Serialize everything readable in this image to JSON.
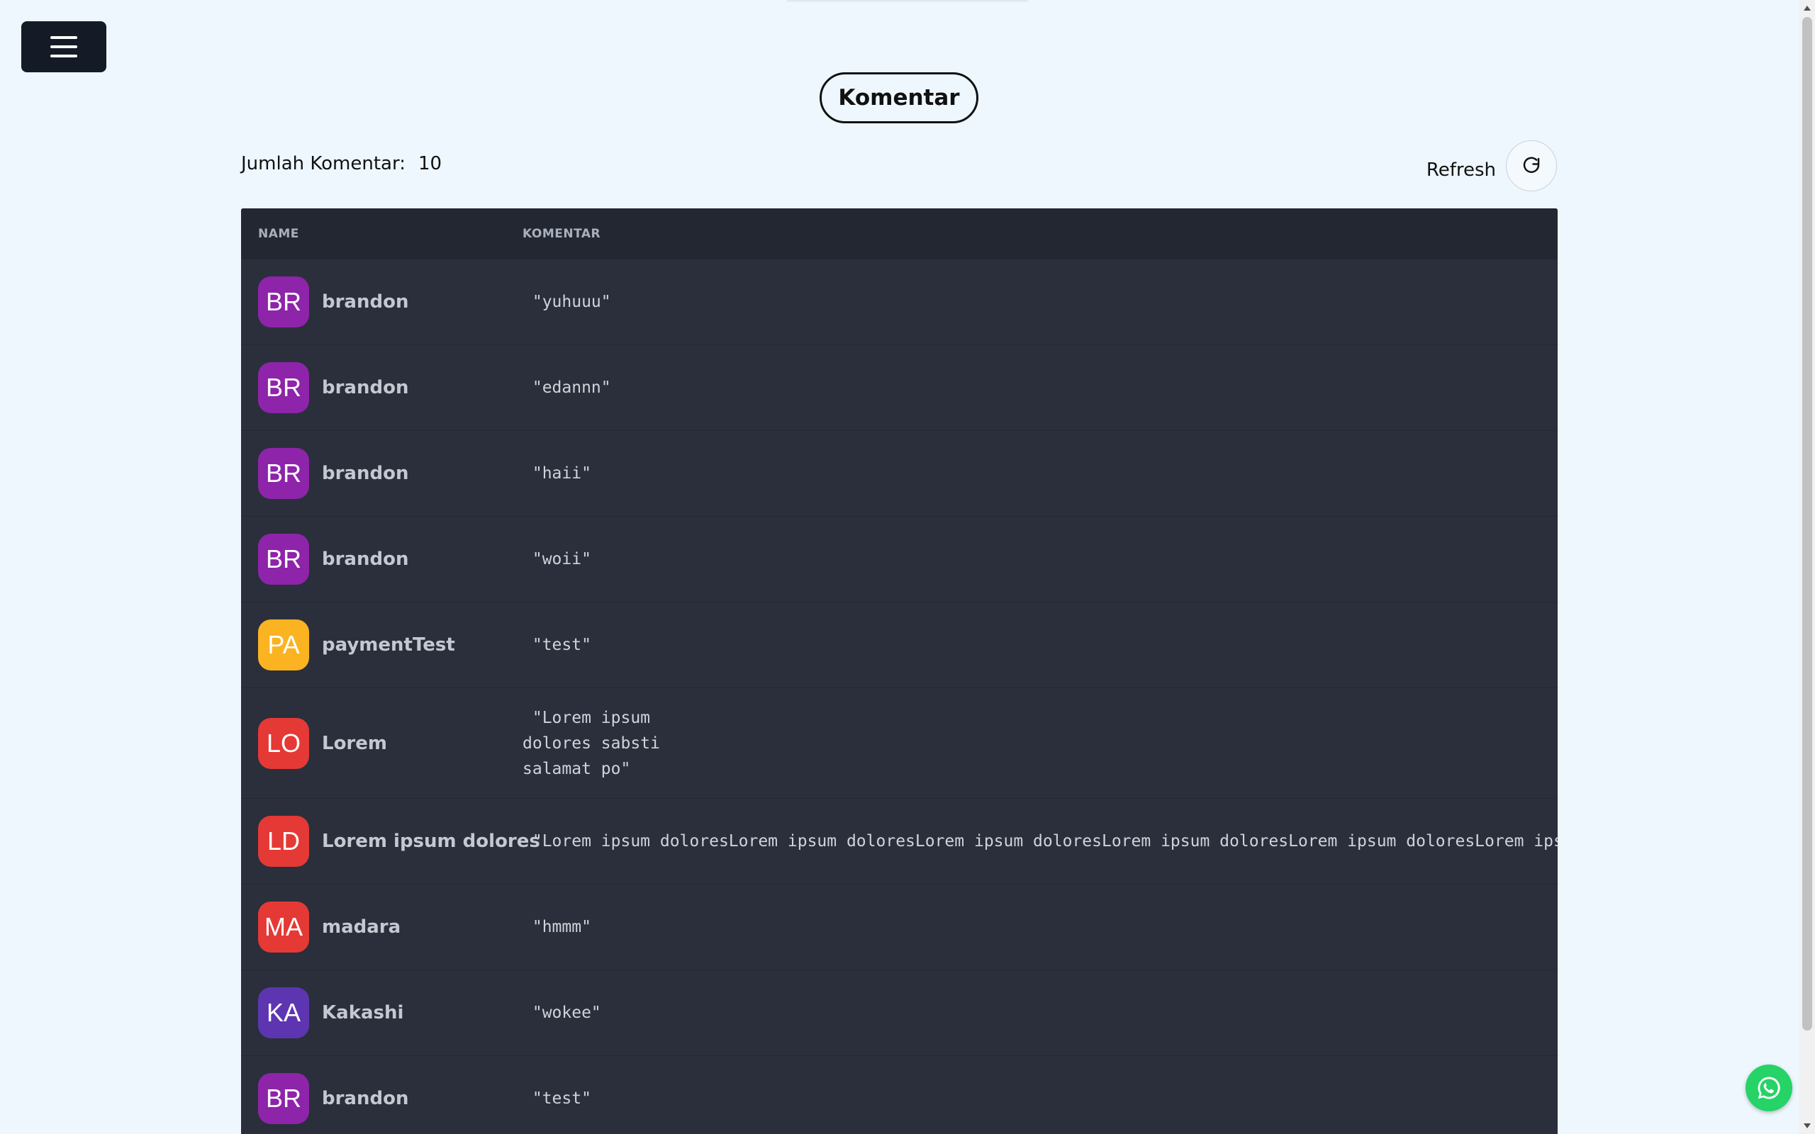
{
  "page": {
    "title": "Komentar",
    "count_label": "Jumlah Komentar:",
    "count_value": "10",
    "refresh_label": "Refresh"
  },
  "table": {
    "headers": {
      "name": "NAME",
      "komentar": "KOMENTAR"
    },
    "rows": [
      {
        "initials": "BR",
        "name": "brandon",
        "comment": " \"yuhuuu\"",
        "avatar_color": "#8e24aa"
      },
      {
        "initials": "BR",
        "name": "brandon",
        "comment": " \"edannn\"",
        "avatar_color": "#8e24aa"
      },
      {
        "initials": "BR",
        "name": "brandon",
        "comment": " \"haii\"",
        "avatar_color": "#8e24aa"
      },
      {
        "initials": "BR",
        "name": "brandon",
        "comment": " \"woii\"",
        "avatar_color": "#8e24aa"
      },
      {
        "initials": "PA",
        "name": "paymentTest",
        "comment": " \"test\"",
        "avatar_color": "#fbb321"
      },
      {
        "initials": "LO",
        "name": "Lorem",
        "comment": " \"Lorem ipsum\ndolores sabsti\nsalamat po\"",
        "avatar_color": "#e53935"
      },
      {
        "initials": "LD",
        "name": "Lorem ipsum dolores",
        "comment": " \"Lorem ipsum doloresLorem ipsum doloresLorem ipsum doloresLorem ipsum doloresLorem ipsum doloresLorem ipsum",
        "avatar_color": "#e53935"
      },
      {
        "initials": "MA",
        "name": "madara",
        "comment": " \"hmmm\"",
        "avatar_color": "#e53935"
      },
      {
        "initials": "KA",
        "name": "Kakashi",
        "comment": " \"wokee\"",
        "avatar_color": "#5e35b1"
      },
      {
        "initials": "BR",
        "name": "brandon",
        "comment": " \"test\"",
        "avatar_color": "#8e24aa"
      }
    ]
  },
  "icons": {
    "menu": "hamburger-icon",
    "refresh": "refresh-icon",
    "whatsapp": "whatsapp-icon"
  },
  "colors": {
    "background": "#eef7fe",
    "table_bg": "#2a2f3b",
    "table_header_bg": "#232731",
    "whatsapp": "#25d366"
  }
}
